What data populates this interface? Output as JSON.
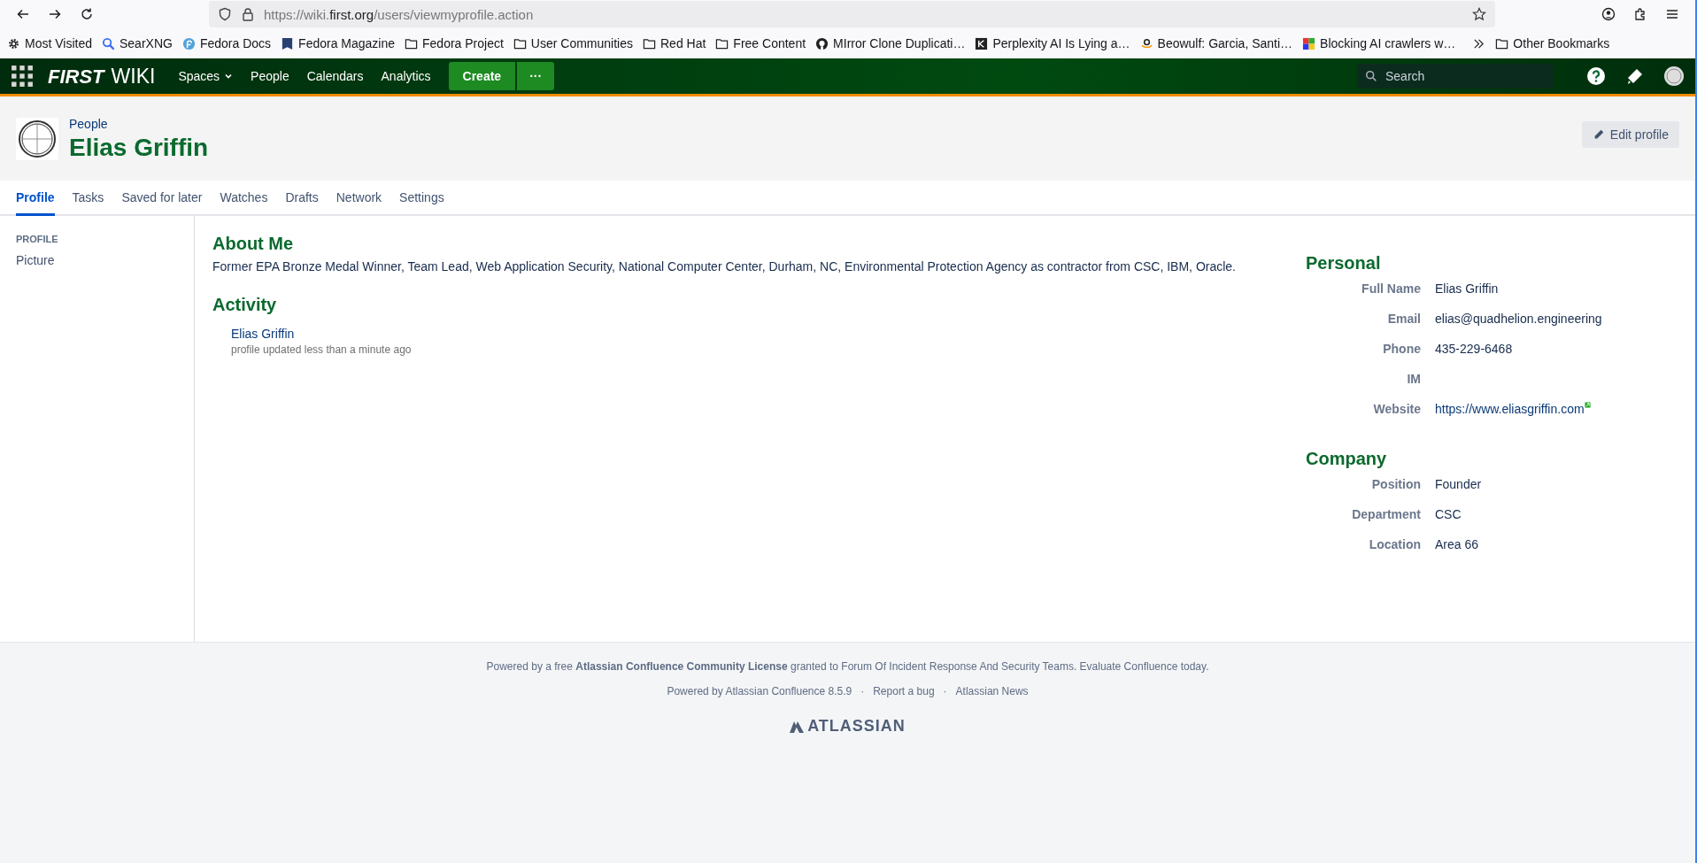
{
  "browser": {
    "url_prefix": "https://wiki.",
    "url_domain": "first.org",
    "url_path": "/users/viewmyprofile.action"
  },
  "bookmarks": [
    {
      "label": "Most Visited",
      "kind": "gear"
    },
    {
      "label": "SearXNG",
      "kind": "search"
    },
    {
      "label": "Fedora Docs",
      "kind": "fedora"
    },
    {
      "label": "Fedora Magazine",
      "kind": "magazine"
    },
    {
      "label": "Fedora Project",
      "kind": "folder"
    },
    {
      "label": "User Communities",
      "kind": "folder"
    },
    {
      "label": "Red Hat",
      "kind": "folder"
    },
    {
      "label": "Free Content",
      "kind": "folder"
    },
    {
      "label": "MIrror Clone Duplicati…",
      "kind": "github"
    },
    {
      "label": "Perplexity AI Is Lying a…",
      "kind": "square"
    },
    {
      "label": "Beowulf: Garcia, Santi…",
      "kind": "amazon"
    },
    {
      "label": "Blocking AI crawlers w…",
      "kind": "colorful"
    }
  ],
  "other_bookmarks": "Other Bookmarks",
  "navbar": {
    "logo_first": "FIRST",
    "logo_wiki": "WIKI",
    "items": [
      {
        "label": "Spaces",
        "dropdown": true
      },
      {
        "label": "People",
        "dropdown": false
      },
      {
        "label": "Calendars",
        "dropdown": false
      },
      {
        "label": "Analytics",
        "dropdown": false
      }
    ],
    "create": "Create",
    "more": "···",
    "search": {
      "placeholder": "Search"
    }
  },
  "header": {
    "breadcrumb": "People",
    "name": "Elias Griffin",
    "edit_button": "Edit profile"
  },
  "tabs": [
    {
      "label": "Profile",
      "selected": true
    },
    {
      "label": "Tasks",
      "selected": false
    },
    {
      "label": "Saved for later",
      "selected": false
    },
    {
      "label": "Watches",
      "selected": false
    },
    {
      "label": "Drafts",
      "selected": false
    },
    {
      "label": "Network",
      "selected": false
    },
    {
      "label": "Settings",
      "selected": false
    }
  ],
  "sidebar": {
    "heading": "PROFILE",
    "items": [
      {
        "label": "Picture"
      }
    ]
  },
  "about": {
    "title": "About Me",
    "text": "Former EPA Bronze Medal Winner, Team Lead, Web Application Security, National Computer Center, Durham, NC, Environmental Protection Agency as contractor from CSC, IBM, Oracle."
  },
  "activity": {
    "title": "Activity",
    "items": [
      {
        "name": "Elias Griffin",
        "detail": "profile updated less than a minute ago"
      }
    ]
  },
  "details": [
    {
      "title": "Personal",
      "fields": [
        {
          "label": "Full Name",
          "value": "Elias Griffin",
          "kind": "text"
        },
        {
          "label": "Email",
          "value": "elias@quadhelion.engineering",
          "kind": "text"
        },
        {
          "label": "Phone",
          "value": "435-229-6468",
          "kind": "text"
        },
        {
          "label": "IM"
        },
        {
          "label": "Website",
          "value": "https://www.eliasgriffin.com",
          "kind": "link"
        }
      ]
    },
    {
      "title": "Company",
      "fields": [
        {
          "label": "Position",
          "value": "Founder",
          "kind": "text"
        },
        {
          "label": "Department",
          "value": "CSC",
          "kind": "text"
        },
        {
          "label": "Location",
          "value": "Area 66",
          "kind": "text"
        }
      ]
    }
  ],
  "footer": {
    "license": "Powered by a free **Atlassian Confluence Community License** granted to Forum Of Incident Response And Security Teams. Evaluate Confluence today.",
    "links": [
      "Powered by Atlassian Confluence 8.5.9",
      "Report a bug",
      "Atlassian News"
    ],
    "separator": "·",
    "logo": "ATLASSIAN"
  }
}
